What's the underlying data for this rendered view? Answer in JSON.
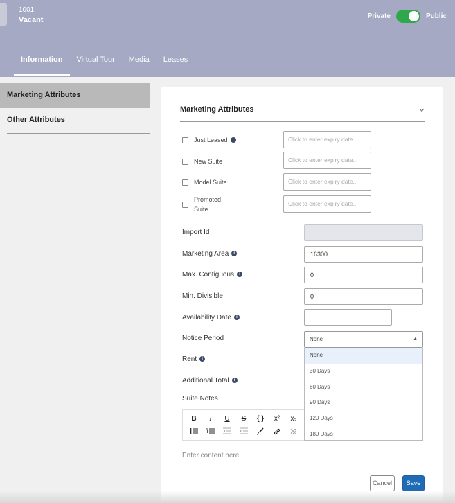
{
  "header": {
    "unit_number": "1001",
    "unit_status": "Vacant",
    "toggle": {
      "left_label": "Private",
      "right_label": "Public",
      "state": "on"
    },
    "tabs": [
      {
        "label": "Information",
        "active": true
      },
      {
        "label": "Virtual Tour",
        "active": false
      },
      {
        "label": "Media",
        "active": false
      },
      {
        "label": "Leases",
        "active": false
      }
    ]
  },
  "sidebar": {
    "items": [
      {
        "label": "Marketing Attributes",
        "active": true
      },
      {
        "label": "Other Attributes",
        "active": false
      }
    ]
  },
  "panel": {
    "title": "Marketing Attributes",
    "collapse_icon": "chevron-down-icon",
    "checkbox_rows": [
      {
        "label": "Just Leased",
        "info": true,
        "placeholder": "Click to enter expiry date..."
      },
      {
        "label": "New Suite",
        "info": false,
        "placeholder": "Click to enter expiry date..."
      },
      {
        "label": "Model Suite",
        "info": false,
        "placeholder": "Click to enter expiry date..."
      },
      {
        "label_line1": "Promoted",
        "label_line2": "Suite",
        "info": false,
        "placeholder": "Click to enter expiry date..."
      }
    ],
    "fields": {
      "import_id": {
        "label": "Import Id",
        "value": ""
      },
      "marketing_area": {
        "label": "Marketing Area",
        "value": "16300"
      },
      "max_contiguous": {
        "label": "Max. Contiguous",
        "value": "0"
      },
      "min_divisible": {
        "label": "Min. Divisible",
        "value": "0"
      },
      "availability_date": {
        "label": "Availability Date",
        "value": ""
      },
      "notice_period": {
        "label": "Notice Period",
        "value": "None"
      },
      "rent": {
        "label": "Rent"
      },
      "additional_total": {
        "label": "Additional Total"
      },
      "suite_notes": {
        "label": "Suite Notes",
        "placeholder": "Enter content here..."
      }
    },
    "notice_options": [
      "None",
      "30 Days",
      "60 Days",
      "90 Days",
      "120 Days",
      "180 Days"
    ],
    "toolbar_row1": [
      "B",
      "I",
      "U",
      "S",
      "{ }",
      "x²",
      "x₂"
    ],
    "toolbar_row2": [
      "bulleted-list-icon",
      "numbered-list-icon",
      "outdent-icon",
      "indent-icon",
      "brush-icon",
      "link-icon",
      "unlink-icon"
    ],
    "buttons": {
      "cancel": "Cancel",
      "save": "Save"
    },
    "colors": {
      "header": "#a5a9c4",
      "toggle_on": "#2ea84a",
      "save": "#1f6cb5"
    }
  }
}
